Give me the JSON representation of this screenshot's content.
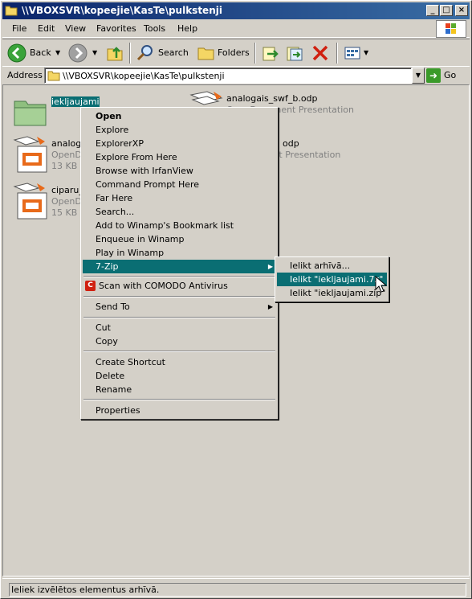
{
  "window": {
    "title": "\\\\VBOXSVR\\kopeejie\\KasTe\\pulkstenji",
    "buttons": {
      "minimize": "_",
      "maximize": "□",
      "close": "×"
    }
  },
  "menubar": {
    "items": [
      "File",
      "Edit",
      "View",
      "Favorites",
      "Tools",
      "Help"
    ]
  },
  "toolbar": {
    "back": "Back",
    "search": "Search",
    "folders": "Folders"
  },
  "address": {
    "label": "Address",
    "value": "\\\\VBOXSVR\\kopeejie\\KasTe\\pulkstenji",
    "go": "Go"
  },
  "files": [
    {
      "name": "iekljaujami",
      "type": "",
      "size": ""
    },
    {
      "name": "analogais_swf_b.odp",
      "type": "OpenDocument Presentation",
      "size": ""
    },
    {
      "name": "analogais",
      "type": "OpenDo",
      "size": "13 KB"
    },
    {
      "name": "odp",
      "type": "ument Presentation",
      "size": ""
    },
    {
      "name": "ciparu_s",
      "type": "OpenDo",
      "size": "15 KB"
    }
  ],
  "context_menu": {
    "items": {
      "open": "Open",
      "explore": "Explore",
      "explorerxp": "ExplorerXP",
      "explore_from_here": "Explore From Here",
      "browse_irfanview": "Browse with IrfanView",
      "command_prompt": "Command Prompt Here",
      "far_here": "Far Here",
      "search": "Search...",
      "winamp_bookmark": "Add to Winamp's Bookmark list",
      "enqueue_winamp": "Enqueue in Winamp",
      "play_winamp": "Play in Winamp",
      "sevenzip": "7-Zip",
      "comodo": "Scan with COMODO Antivirus",
      "send_to": "Send To",
      "cut": "Cut",
      "copy": "Copy",
      "create_shortcut": "Create Shortcut",
      "delete": "Delete",
      "rename": "Rename",
      "properties": "Properties"
    }
  },
  "submenu": {
    "items": {
      "add_archive": "Ielikt arhīvā...",
      "add_7z": "Ielikt \"iekljaujami.7z\"",
      "add_zip": "Ielikt \"iekljaujami.zip\""
    }
  },
  "status": {
    "text": "Ieliek izvēlētos elementus arhīvā."
  },
  "colors": {
    "title_start": "#0a246a",
    "title_end": "#3a6ea5",
    "highlight": "#0a6e73",
    "face": "#d4d0c8"
  }
}
